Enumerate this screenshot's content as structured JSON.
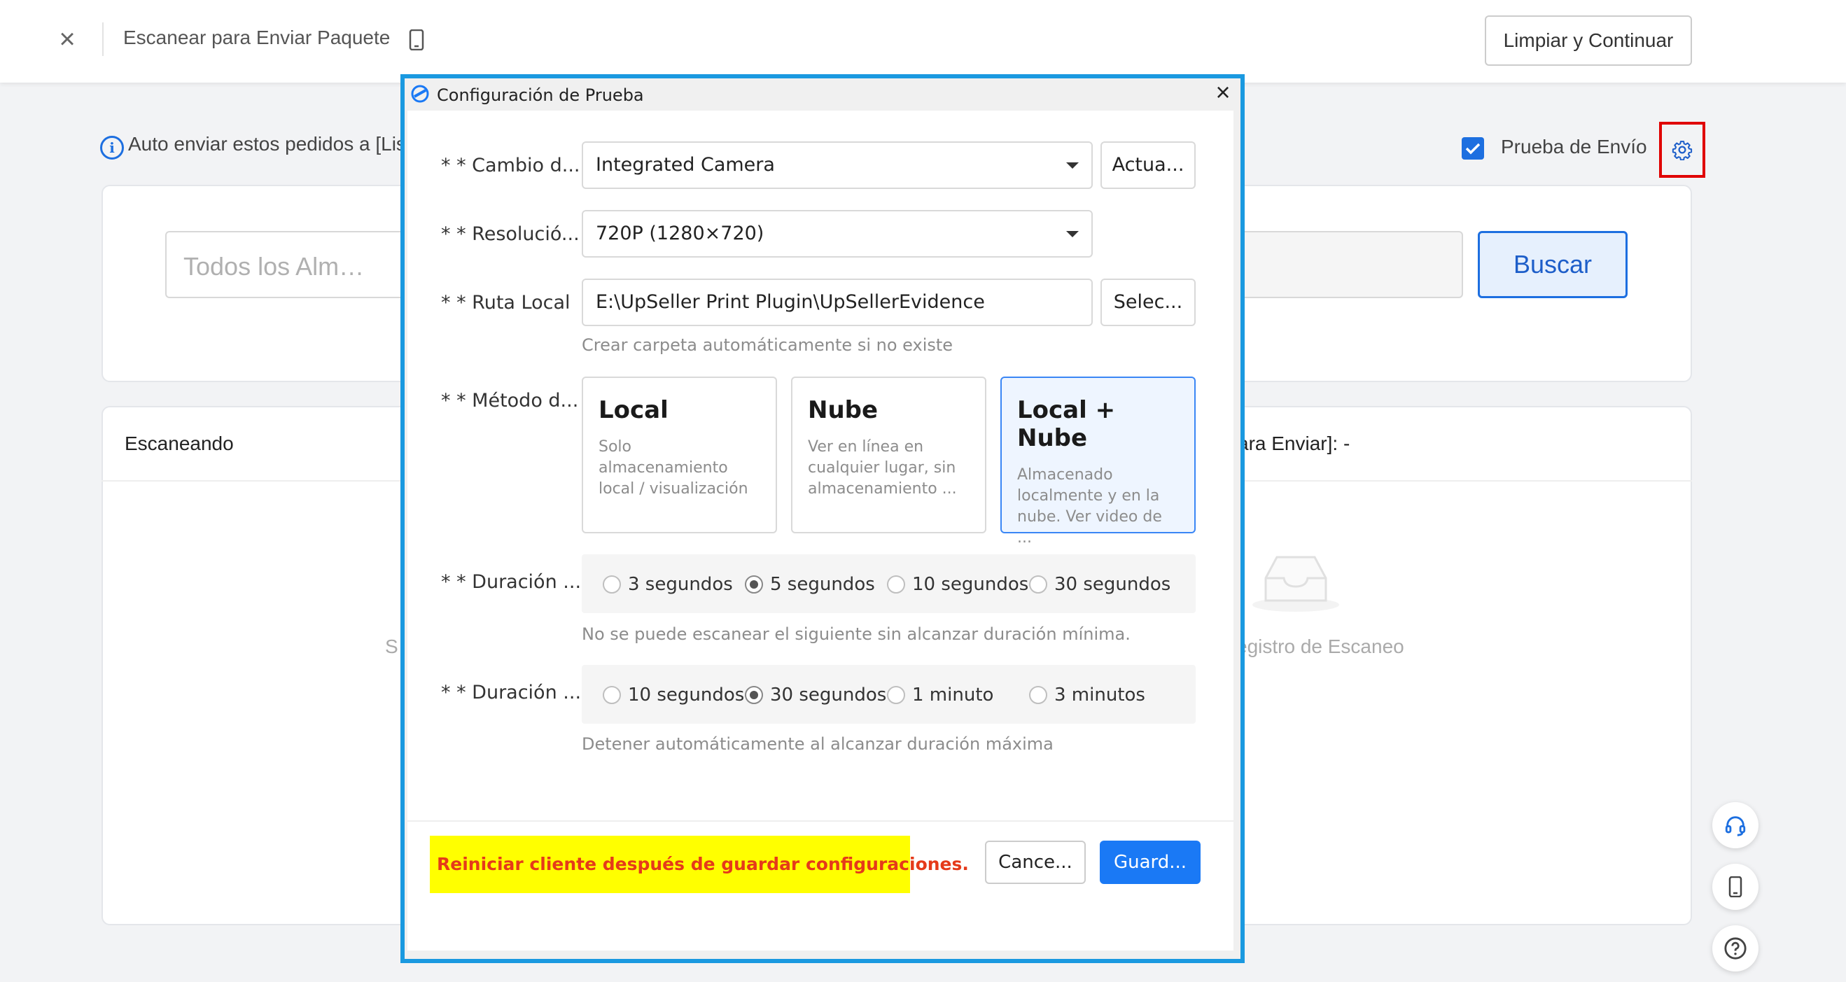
{
  "header": {
    "title": "Escanear para Enviar Paquete",
    "clear_continue": "Limpiar y Continuar"
  },
  "page": {
    "notice": "Auto enviar estos pedidos a [Lis",
    "test_shipping_label": "Prueba de Envío",
    "warehouse_placeholder": "Todos los Alm…",
    "search_button": "Buscar",
    "scanning_title": "Escaneando",
    "send_status": "ara Enviar]: -",
    "empty_text": "egistro de Escaneo",
    "left_fragment": "S"
  },
  "dialog": {
    "title": "Configuración de Prueba",
    "camera": {
      "label": "* * Cambio d...",
      "value": "Integrated Camera",
      "button": "Actua..."
    },
    "resolution": {
      "label": "* * Resolució...",
      "value": "720P (1280×720)"
    },
    "local_path": {
      "label": "* * Ruta Local",
      "value": "E:\\UpSeller Print Plugin\\UpSellerEvidence",
      "button": "Selec...",
      "hint": "Crear carpeta automáticamente si no existe"
    },
    "method": {
      "label": "* * Método d...",
      "options": [
        {
          "title": "Local",
          "desc": "Solo almacenamiento local / visualización"
        },
        {
          "title": "Nube",
          "desc": "Ver en línea en cualquier lugar, sin almacenamiento ..."
        },
        {
          "title": "Local + Nube",
          "desc": "Almacenado localmente y en la nube. Ver video de ..."
        }
      ],
      "selected": "Local + Nube"
    },
    "min_duration": {
      "label": "* * Duración ...",
      "options": [
        "3 segundos",
        "5 segundos",
        "10 segundos",
        "30 segundos"
      ],
      "selected": "5 segundos",
      "hint": "No se puede escanear el siguiente sin alcanzar duración mínima."
    },
    "max_duration": {
      "label": "* * Duración ...",
      "options": [
        "10 segundos",
        "30 segundos",
        "1 minuto",
        "3 minutos"
      ],
      "selected": "30 segundos",
      "hint": "Detener automáticamente al alcanzar duración máxima"
    },
    "warning": "Reiniciar cliente después de guardar configuraciones.",
    "cancel": "Cance...",
    "save": "Guard..."
  },
  "colors": {
    "primary": "#1a79f5",
    "dialog_border": "#1a99e0",
    "warning_bg": "#ffff00",
    "warning_text": "#e53a1a",
    "highlight_box": "#e00000"
  },
  "icons": [
    "close-icon",
    "phone-icon",
    "info-icon",
    "checkbox-icon",
    "gear-icon",
    "empty-inbox-icon",
    "headset-icon",
    "mobile-icon",
    "help-icon",
    "app-logo-icon",
    "dropdown-caret-icon"
  ]
}
